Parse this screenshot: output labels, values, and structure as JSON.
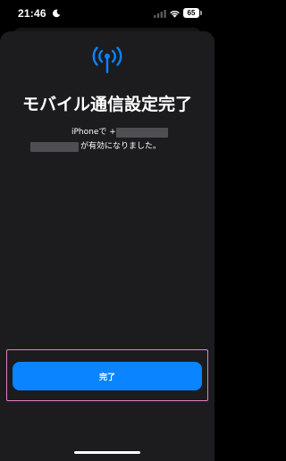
{
  "status_bar": {
    "time": "21:46",
    "battery_level": "65",
    "icons": [
      "moon-icon",
      "signal-icon",
      "wifi-icon",
      "battery-icon"
    ]
  },
  "main": {
    "icon": "antenna-icon",
    "title": "モバイル通信設定完了",
    "message_line1": "iPhoneで +81",
    "message_line2": "が有効になりました。"
  },
  "footer": {
    "done_label": "完了"
  },
  "colors": {
    "accent": "#0a84ff",
    "sheet_background": "#1c1c1e",
    "highlight": "#e87fc6"
  }
}
